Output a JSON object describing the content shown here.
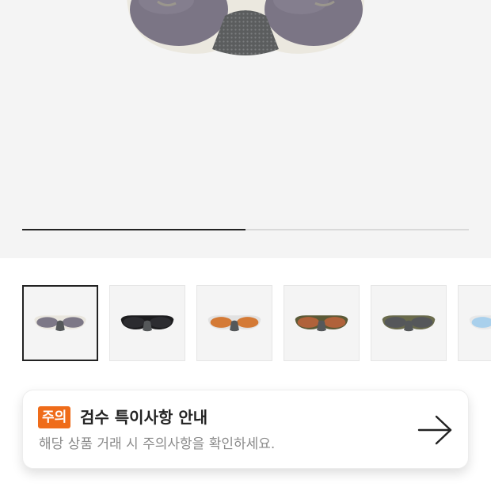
{
  "gallery": {
    "progress": 0.5,
    "thumbnails": [
      {
        "name": "thumb-sunglasses-white-grey",
        "frame": "#e9e6de",
        "lens": "#7d7887",
        "selected": true
      },
      {
        "name": "thumb-sunglasses-black",
        "frame": "#1c1c1e",
        "lens": "#2c2c30",
        "selected": false
      },
      {
        "name": "thumb-sunglasses-orange",
        "frame": "#e2e2e2",
        "lens": "#d47a36",
        "selected": false
      },
      {
        "name": "thumb-sunglasses-olive-bronze",
        "frame": "#5b5a37",
        "lens": "#b0623a",
        "selected": false
      },
      {
        "name": "thumb-sunglasses-olive-grey",
        "frame": "#6a6b4c",
        "lens": "#55575a",
        "selected": false
      },
      {
        "name": "thumb-sunglasses-ice-blue",
        "frame": "#e8e8e8",
        "lens": "#a9d0ec",
        "selected": false
      }
    ]
  },
  "notice": {
    "badge": "주의",
    "title": "검수 특이사항 안내",
    "subtitle": "해당 상품 거래 시 주의사항을 확인하세요.",
    "arrow_icon": "arrow-right-icon",
    "badge_color": "#ef6c1a"
  }
}
